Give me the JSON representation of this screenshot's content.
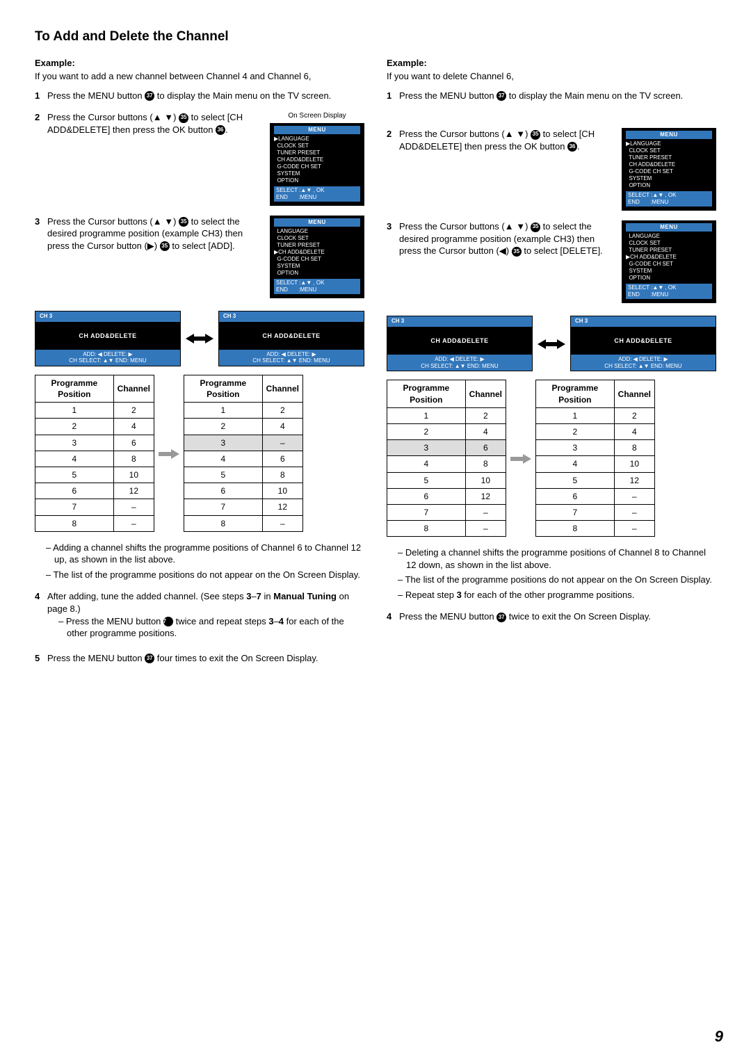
{
  "pageTitle": "To Add and Delete the Channel",
  "pageNumber": "9",
  "exampleLabel": "Example:",
  "osdCaption": "On Screen Display",
  "arrows": {
    "up": "▲",
    "down": "▼",
    "left": "◀",
    "right": "▶"
  },
  "refs": {
    "r35": "35",
    "r36": "36",
    "r37": "37"
  },
  "left": {
    "intro": "If you want to add a new channel between Channel 4 and Channel 6,",
    "step1": {
      "n": "1",
      "t1": "Press the MENU button ",
      "t2": " to display the Main menu on the TV screen."
    },
    "step2": {
      "n": "2",
      "t1": "Press the Cursor buttons (",
      "t2": ") ",
      "t3": " to select [CH ADD&DELETE] then press the OK button ",
      "t4": "."
    },
    "step3": {
      "n": "3",
      "t1": "Press the Cursor buttons (",
      "t2": ") ",
      "t3": " to select the desired programme position (example CH3) then press the Cursor button (",
      "t4": ") ",
      "t5": " to select [ADD]."
    },
    "notesA": "– Adding a channel shifts the programme positions of Channel 6 to Channel 12 up, as shown in the list above.",
    "notesB": "– The list of the programme positions do not appear on the On Screen Display.",
    "step4": {
      "n": "4",
      "t1": "After adding, tune the added channel. (See steps ",
      "t2": "3",
      "t3": "–",
      "t4": "7",
      "t5": " in ",
      "t6": "Manual Tuning",
      "t7": " on page 8.)"
    },
    "step4sub": {
      "t1": "– Press the MENU button ",
      "t2": " twice and repeat steps ",
      "t3": "3",
      "t4": "–",
      "t5": "4",
      "t6": " for each of the other programme positions."
    },
    "step5": {
      "n": "5",
      "t1": "Press the MENU button ",
      "t2": " four times to exit the On Screen Display."
    },
    "tableBefore": [
      [
        "1",
        "2"
      ],
      [
        "2",
        "4"
      ],
      [
        "3",
        "6"
      ],
      [
        "4",
        "8"
      ],
      [
        "5",
        "10"
      ],
      [
        "6",
        "12"
      ],
      [
        "7",
        "–"
      ],
      [
        "8",
        "–"
      ]
    ],
    "tableAfter": [
      [
        "1",
        "2"
      ],
      [
        "2",
        "4"
      ],
      [
        "3",
        "–"
      ],
      [
        "4",
        "6"
      ],
      [
        "5",
        "8"
      ],
      [
        "6",
        "10"
      ],
      [
        "7",
        "12"
      ],
      [
        "8",
        "–"
      ]
    ],
    "highlightBefore": -1,
    "highlightAfter": 2
  },
  "right": {
    "intro": "If you want to delete Channel 6,",
    "step1": {
      "n": "1",
      "t1": "Press the MENU button ",
      "t2": " to display the Main menu on the TV screen."
    },
    "step2": {
      "n": "2",
      "t1": "Press the Cursor buttons (",
      "t2": ") ",
      "t3": " to select [CH ADD&DELETE] then press the OK button ",
      "t4": "."
    },
    "step3": {
      "n": "3",
      "t1": "Press the Cursor buttons (",
      "t2": ") ",
      "t3": " to select the desired programme position (example CH3) then press the Cursor button (",
      "t4": ") ",
      "t5": " to select [DELETE]."
    },
    "notesA": "– Deleting a channel shifts the programme positions of Channel 8 to Channel 12 down, as shown in the list above.",
    "notesB": "– The list of the programme positions do not appear on the On Screen Display.",
    "notesC": {
      "t1": "– Repeat step ",
      "t2": "3",
      "t3": " for each of the other programme positions."
    },
    "step4": {
      "n": "4",
      "t1": "Press the MENU button ",
      "t2": " twice to exit the On Screen Display."
    },
    "tableBefore": [
      [
        "1",
        "2"
      ],
      [
        "2",
        "4"
      ],
      [
        "3",
        "6"
      ],
      [
        "4",
        "8"
      ],
      [
        "5",
        "10"
      ],
      [
        "6",
        "12"
      ],
      [
        "7",
        "–"
      ],
      [
        "8",
        "–"
      ]
    ],
    "tableAfter": [
      [
        "1",
        "2"
      ],
      [
        "2",
        "4"
      ],
      [
        "3",
        "8"
      ],
      [
        "4",
        "10"
      ],
      [
        "5",
        "12"
      ],
      [
        "6",
        "–"
      ],
      [
        "7",
        "–"
      ],
      [
        "8",
        "–"
      ]
    ],
    "highlightBefore": 2,
    "highlightAfter": -1
  },
  "osdMenu1": {
    "title": "MENU",
    "lines": [
      "▶LANGUAGE",
      "  CLOCK SET",
      "  TUNER PRESET",
      "  CH ADD&DELETE",
      "  G-CODE CH SET",
      "  SYSTEM",
      "  OPTION"
    ],
    "footer": [
      "SELECT :▲▼ , OK",
      "END       :MENU"
    ]
  },
  "osdMenu2": {
    "title": "MENU",
    "lines": [
      "  LANGUAGE",
      "  CLOCK SET",
      "  TUNER PRESET",
      "▶CH ADD&DELETE",
      "  G-CODE CH SET",
      "  SYSTEM",
      "  OPTION"
    ],
    "footer": [
      "SELECT :▲▼ , OK",
      "END       :MENU"
    ]
  },
  "chBox": {
    "top": "CH 3",
    "mid": "CH ADD&DELETE",
    "bot1": "ADD: ◀   DELETE: ▶",
    "bot2": "CH SELECT: ▲▼   END: MENU"
  },
  "tableHeaders": {
    "pos": "Programme Position",
    "ch": "Channel"
  }
}
